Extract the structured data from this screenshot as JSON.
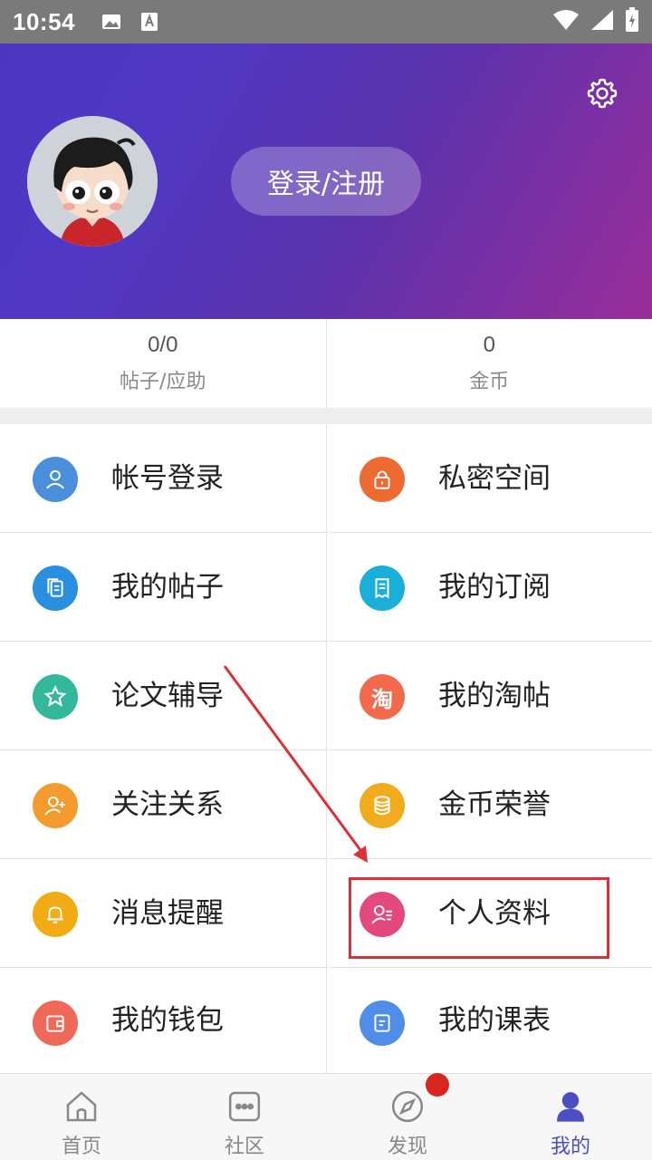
{
  "status_bar": {
    "time": "10:54"
  },
  "header": {
    "login_label": "登录/注册"
  },
  "stats": [
    {
      "value": "0/0",
      "label": "帖子/应助"
    },
    {
      "value": "0",
      "label": "金币"
    }
  ],
  "menu": {
    "items": [
      {
        "label": "帐号登录",
        "icon": "user-icon",
        "color": "#4a8fdc"
      },
      {
        "label": "私密空间",
        "icon": "lock-icon",
        "color": "#ee6a33"
      },
      {
        "label": "我的帖子",
        "icon": "document-icon",
        "color": "#2b8fe0"
      },
      {
        "label": "我的订阅",
        "icon": "receipt-icon",
        "color": "#1aaed9"
      },
      {
        "label": "论文辅导",
        "icon": "star-icon",
        "color": "#33b89c"
      },
      {
        "label": "我的淘帖",
        "icon": "taobao-icon",
        "color": "#f26a4b",
        "glyph": "淘"
      },
      {
        "label": "关注关系",
        "icon": "add-user-icon",
        "color": "#f49b2e"
      },
      {
        "label": "金币荣誉",
        "icon": "coins-icon",
        "color": "#f2ab1c"
      },
      {
        "label": "消息提醒",
        "icon": "bell-icon",
        "color": "#f1ab15"
      },
      {
        "label": "个人资料",
        "icon": "profile-icon",
        "color": "#e5487a"
      },
      {
        "label": "我的钱包",
        "icon": "wallet-icon",
        "color": "#f06857"
      },
      {
        "label": "我的课表",
        "icon": "schedule-icon",
        "color": "#4f8de8"
      }
    ]
  },
  "bottom_nav": {
    "items": [
      {
        "label": "首页",
        "icon": "home-icon"
      },
      {
        "label": "社区",
        "icon": "chat-icon"
      },
      {
        "label": "发现",
        "icon": "compass-icon"
      },
      {
        "label": "我的",
        "icon": "person-icon"
      }
    ],
    "active_index": 3
  },
  "colors": {
    "accent": "#4a4fc4",
    "header_gradient_start": "#4b36c2",
    "header_gradient_end": "#9a2d98",
    "annotation": "#d9303a",
    "badge": "#d8261f"
  }
}
